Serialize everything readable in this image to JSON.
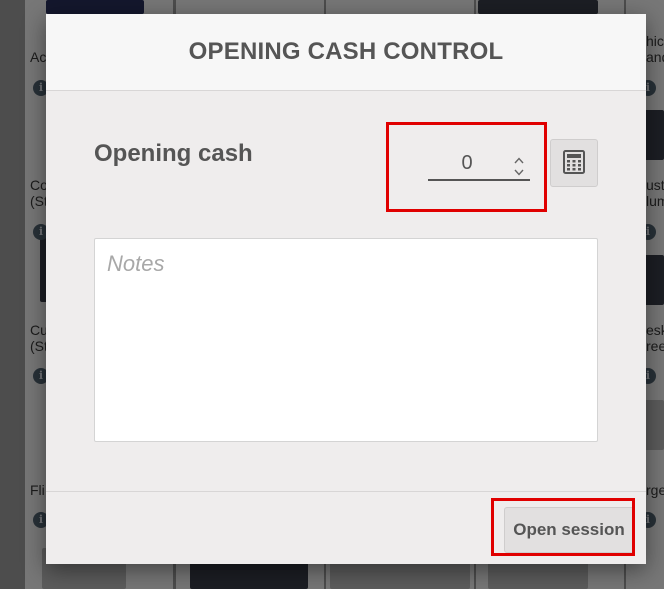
{
  "dialog": {
    "title": "OPENING CASH CONTROL",
    "opening_cash_label": "Opening cash",
    "opening_cash_value": "0",
    "calculator_icon": "calculator-icon",
    "notes_placeholder": "Notes",
    "open_session_label": "Open session"
  },
  "background_products": {
    "labels": [
      "Ac",
      "Co",
      "(St",
      "Cu",
      "(St",
      "Fli",
      "hick",
      "and",
      "ust",
      "lum",
      "esk",
      "ree",
      "rge"
    ],
    "info_icon": "info-icon"
  },
  "highlight_color": "#e00000"
}
